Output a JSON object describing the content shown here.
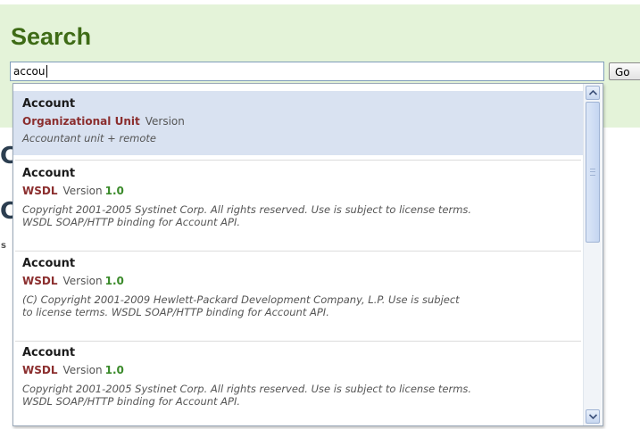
{
  "search": {
    "title": "Search",
    "query": "accou",
    "go_label": "Go"
  },
  "background_fragments": [
    "C",
    "C",
    "s"
  ],
  "results": [
    {
      "title": "Account",
      "type": "Organizational Unit",
      "version_label": "Version",
      "version": "",
      "description": "Accountant unit + remote",
      "selected": true
    },
    {
      "title": "Account",
      "type": "WSDL",
      "version_label": "Version",
      "version": "1.0",
      "description_lines": [
        "Copyright 2001-2005 Systinet Corp. All rights reserved. Use is subject to license terms.",
        "WSDL SOAP/HTTP binding for Account API."
      ],
      "selected": false
    },
    {
      "title": "Account",
      "type": "WSDL",
      "version_label": "Version",
      "version": "1.0",
      "description_lines": [
        "(C) Copyright 2001-2009 Hewlett-Packard Development Company, L.P. Use is subject",
        "to license terms. WSDL SOAP/HTTP binding for Account API."
      ],
      "selected": false
    },
    {
      "title": "Account",
      "type": "WSDL",
      "version_label": "Version",
      "version": "1.0",
      "description_lines": [
        "Copyright 2001-2005 Systinet Corp. All rights reserved. Use is subject to license terms.",
        "WSDL SOAP/HTTP binding for Account API."
      ],
      "selected": false
    }
  ],
  "scrollbar": {
    "up_icon": "scroll-up-arrow",
    "down_icon": "scroll-down-arrow",
    "position_fraction": 0.0
  },
  "colors": {
    "panel_bg": "#e4f3d9",
    "title": "#3e6b16",
    "type": "#8b2e2e",
    "version": "#3a8a2a",
    "selected_bg": "#d9e2f1"
  }
}
